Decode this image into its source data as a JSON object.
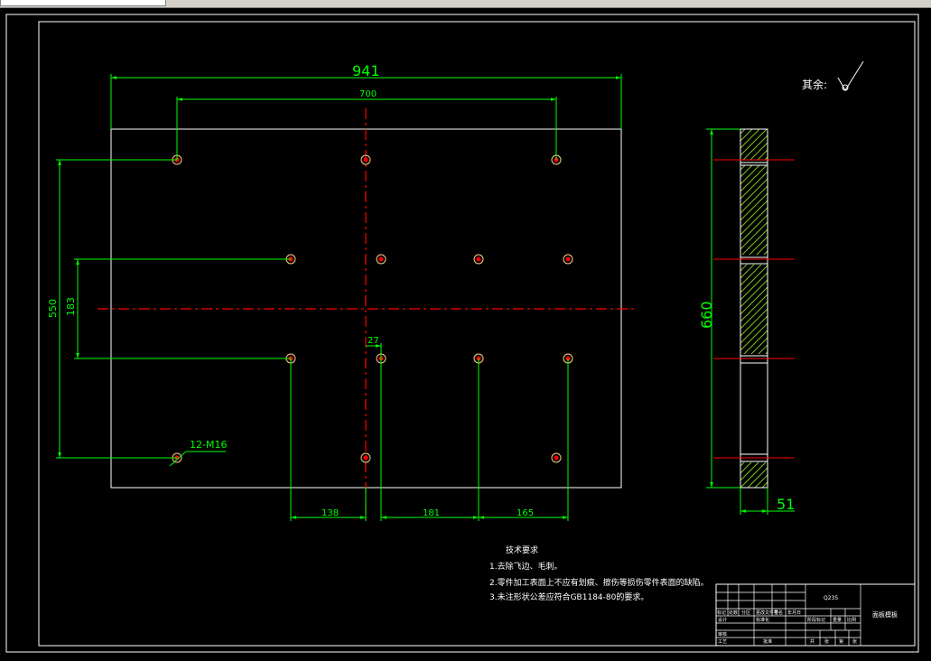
{
  "surface_finish": {
    "label": "其余:"
  },
  "dimensions": {
    "overall_width": "941",
    "hole_span": "700",
    "overall_height": "550",
    "row_spacing": "183",
    "center_offset": "27",
    "left_offset": "138",
    "mid_spacing": "181",
    "right_spacing": "165",
    "side_height": "660",
    "side_thickness": "51"
  },
  "hole_callout": "12-M16",
  "tech_requirements": {
    "title": "技术要求",
    "items": [
      "1.去除飞边、毛刺。",
      "2.零件加工表面上不应有划痕、擦伤等损伤零件表面的缺陷。",
      "3.未注形状公差应符合GB1184-80的要求。"
    ]
  },
  "title_block": {
    "material": "Q235",
    "part_name": "面板模板",
    "cells": [
      "标记",
      "处数",
      "分区",
      "更改文件号",
      "签名",
      "年月日",
      "设计",
      "标准化",
      "阶段标记",
      "重量",
      "比例",
      "审核",
      "工艺",
      "批准",
      "共",
      "张",
      "第",
      "张"
    ]
  },
  "colors": {
    "background": "#000000",
    "outline": "#ffffff",
    "dimension": "#00ff00",
    "centerline": "#ff0000"
  }
}
